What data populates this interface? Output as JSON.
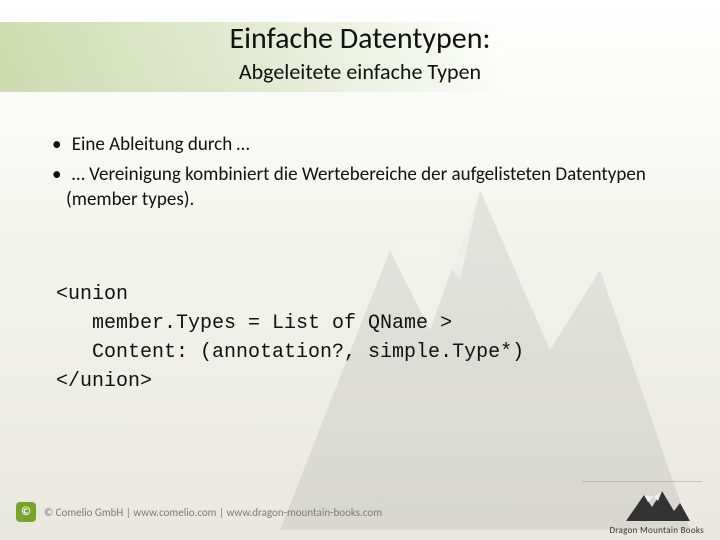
{
  "header": {
    "title": "Einfache Datentypen:",
    "subtitle": "Abgeleitete einfache Typen"
  },
  "bullets": [
    "Eine Ableitung durch …",
    "… Vereinigung kombiniert die Wertebereiche der aufgelisteten Datentypen (member types)."
  ],
  "code": {
    "line1": "<union",
    "line2": "   member.Types = List of QName >",
    "line3": "   Content: (annotation?, simple.Type*)",
    "line4": "</union>"
  },
  "footer": {
    "copyright_symbol": "©",
    "copyright_text": "© Comelio GmbH | www.comelio.com | www.dragon-mountain-books.com",
    "brand": "Dragon Mountain Books"
  },
  "icons": {
    "mountain": "mountain-icon",
    "copyright": "copyright-icon",
    "brand_logo": "mountain-logo-icon"
  }
}
